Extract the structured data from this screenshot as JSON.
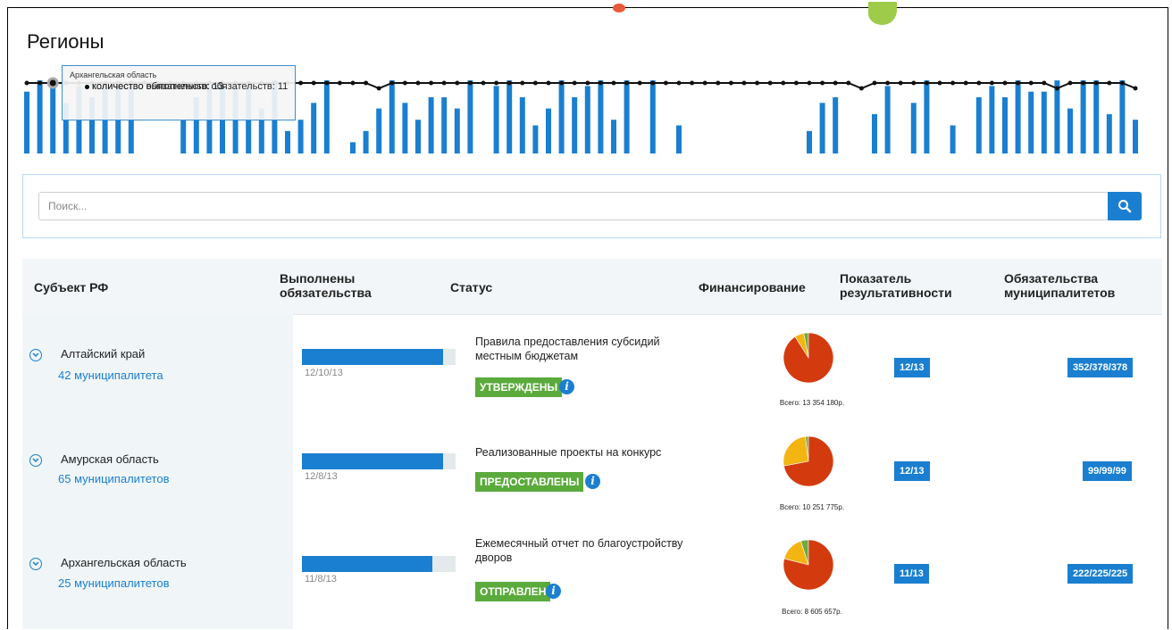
{
  "page": {
    "title": "Регионы"
  },
  "tooltip": {
    "region": "Архангельская область",
    "completed_label": "количество выполненных обязательств: 11",
    "total_label": "количество обязательств: 13",
    "completed_color": "#1a7fd0",
    "total_color": "#111111"
  },
  "search": {
    "placeholder": "Поиск...",
    "button_icon": "search-icon"
  },
  "table": {
    "headers": {
      "subject": "Субъект РФ",
      "completed": "Выполнены обязательства",
      "status": "Статус",
      "financing": "Финансирование",
      "indicator": "Показатель результативности",
      "municipal": "Обязательства муниципалитетов"
    },
    "rows": [
      {
        "region": "Алтайский край",
        "municipalities": "42 муниципалитета",
        "progress": 0.92,
        "progress_label": "12/10/13",
        "status_text": "Правила предоставления субсидий местным бюджетам",
        "status_badge": "УТВЕРЖДЕНЫ",
        "financing_total": "Всего: 13 354 180р.",
        "pie": [
          0.03,
          0.06,
          0.91
        ],
        "indicator": "12/13",
        "municipal": "352/378/378"
      },
      {
        "region": "Амурская область",
        "municipalities": "65 муниципалитетов",
        "progress": 0.92,
        "progress_label": "12/8/13",
        "status_text": "Реализованные проекты на конкурс",
        "status_badge": "ПРЕДОСТАВЛЕНЫ",
        "financing_total": "Всего: 10 251 775р.",
        "pie": [
          0.02,
          0.26,
          0.72
        ],
        "indicator": "12/13",
        "municipal": "99/99/99"
      },
      {
        "region": "Архангельская область",
        "municipalities": "25 муниципалитетов",
        "progress": 0.85,
        "progress_label": "11/8/13",
        "status_text": "Ежемесячный отчет по благоустройству дворов",
        "status_badge": "ОТПРАВЛЕН",
        "financing_total": "Всего: 8 605 657р.",
        "pie": [
          0.05,
          0.16,
          0.79
        ],
        "indicator": "11/13",
        "municipal": "222/225/225"
      }
    ]
  },
  "colors": {
    "accent": "#1a7fd0",
    "status_green": "#5aaa3c",
    "pie_red": "#d33b0f",
    "pie_yellow": "#f3b511",
    "pie_green": "#6eaa3e"
  },
  "sparkline": {
    "bars_completed": [
      11,
      13,
      12,
      9,
      12,
      10,
      12,
      12,
      12,
      0,
      0,
      0,
      6,
      10,
      12,
      12,
      12,
      12,
      8,
      13,
      4,
      6,
      9,
      13,
      0,
      2,
      4,
      8,
      13,
      9,
      6,
      10,
      10,
      8,
      13,
      0,
      12,
      13,
      10,
      5,
      8,
      13,
      10,
      12,
      13,
      6,
      13,
      0,
      13,
      0,
      5,
      0,
      0,
      0,
      0,
      0,
      0,
      0,
      0,
      0,
      4,
      9,
      10,
      0,
      0,
      7,
      12,
      0,
      9,
      13,
      0,
      5,
      0,
      10,
      12,
      10,
      13,
      11,
      11,
      13,
      8,
      13,
      13,
      7,
      13,
      6
    ],
    "line_total": [
      13,
      13,
      13,
      13,
      13,
      13,
      13,
      13,
      13,
      13,
      13,
      13,
      13,
      13,
      13,
      13,
      13,
      13,
      13,
      13,
      13,
      13,
      13,
      13,
      13,
      13,
      13,
      12,
      13,
      13,
      13,
      13,
      13,
      13,
      13,
      13,
      13,
      13,
      13,
      13,
      13,
      13,
      13,
      13,
      13,
      13,
      13,
      13,
      13,
      13,
      13,
      13,
      13,
      13,
      13,
      13,
      13,
      13,
      13,
      13,
      13,
      13,
      13,
      13,
      12,
      13,
      13,
      13,
      13,
      13,
      13,
      13,
      13,
      13,
      13,
      13,
      13,
      13,
      13,
      12,
      13,
      13,
      13,
      13,
      13,
      12
    ]
  }
}
